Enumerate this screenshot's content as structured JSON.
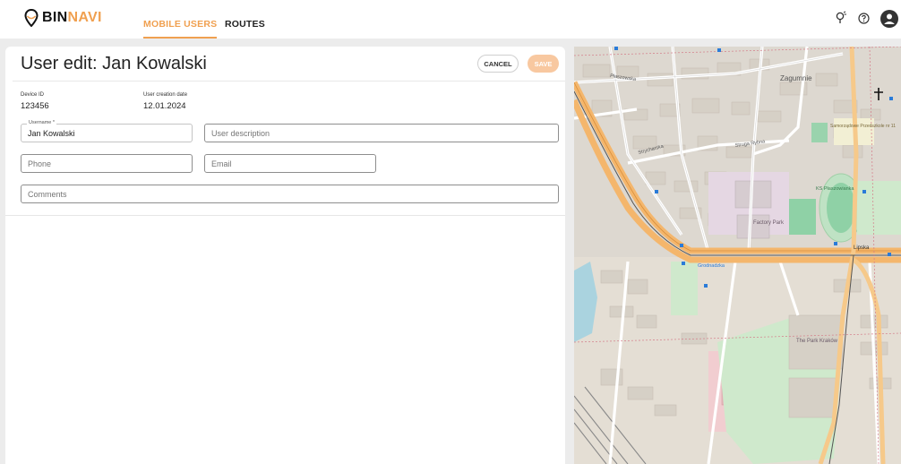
{
  "app": {
    "logo_part1": "BIN",
    "logo_part2": "NAVI",
    "brand_color": "#f0a050"
  },
  "nav": {
    "tabs": [
      {
        "label": "MOBILE USERS",
        "active": true
      },
      {
        "label": "ROUTES",
        "active": false
      }
    ]
  },
  "header_icons": [
    "location-pin-icon",
    "help-icon",
    "account-icon"
  ],
  "page": {
    "title": "User edit: Jan Kowalski",
    "cancel_label": "CANCEL",
    "save_label": "SAVE"
  },
  "meta": {
    "device_id_label": "Device ID",
    "device_id_value": "123456",
    "creation_date_label": "User creation date",
    "creation_date_value": "12.01.2024"
  },
  "form": {
    "username_label": "Username *",
    "username_value": "Jan Kowalski",
    "user_description_placeholder": "User description",
    "phone_placeholder": "Phone",
    "email_placeholder": "Email",
    "comments_placeholder": "Comments"
  },
  "map": {
    "labels": {
      "zagumnie": "Zagumnie",
      "plaszowska": "Płaszowska",
      "strycharska": "Strycharska",
      "struga_rybna": "Struga Rybna",
      "ks_plaszowianka": "KS Płaszowianka",
      "factory_park": "Factory Park",
      "lipska": "Lipska",
      "grodnadzka": "Grodnadzka",
      "the_park_krakow": "The Park Kraków",
      "samorzadowe": "Samorządowe Przedszkole nr 11"
    }
  }
}
